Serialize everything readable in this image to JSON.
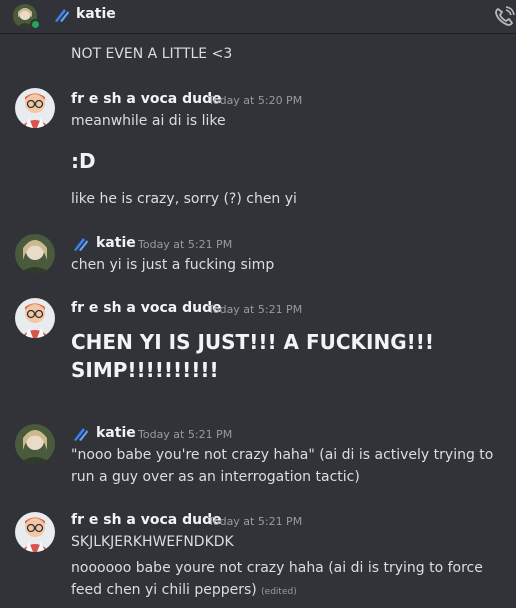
{
  "header": {
    "username": "katie",
    "status_color": "#23a55a",
    "icons": [
      "avatar",
      "nitro-badge-icon",
      "call-icon"
    ]
  },
  "messages": {
    "m0": {
      "text": "NOT EVEN A LITTLE <3"
    },
    "m1": {
      "author": "fr e sh a voca dude",
      "time": "Today at 5:20 PM",
      "line1": "meanwhile ai di is like",
      "line2": ":D",
      "line3": "like he is crazy, sorry (?) chen yi"
    },
    "m2": {
      "author": "katie",
      "time": "Today at 5:21 PM",
      "line1": "chen yi is just a fucking simp"
    },
    "m3": {
      "author": "fr e sh a voca dude",
      "time": "Today at 5:21 PM",
      "line1": "CHEN YI IS JUST!!! A FUCKING!!! SIMP!!!!!!!!!!"
    },
    "m4": {
      "author": "katie",
      "time": "Today at 5:21 PM",
      "line1": "\"nooo babe you're not crazy haha\" (ai di is actively trying to run a guy over as an interrogation tactic)"
    },
    "m5": {
      "author": "fr e sh a voca dude",
      "time": "Today at 5:21 PM",
      "line1": "SKJLKJERKHWEFNDKDK",
      "line2": "noooooo babe youre not crazy haha (ai di is trying to force feed chen yi chili peppers)",
      "edited": "(edited)"
    }
  },
  "colors": {
    "background": "#313338",
    "text": "#dbdee1",
    "timestamp": "#949ba4",
    "badge": "#3b82f6"
  }
}
